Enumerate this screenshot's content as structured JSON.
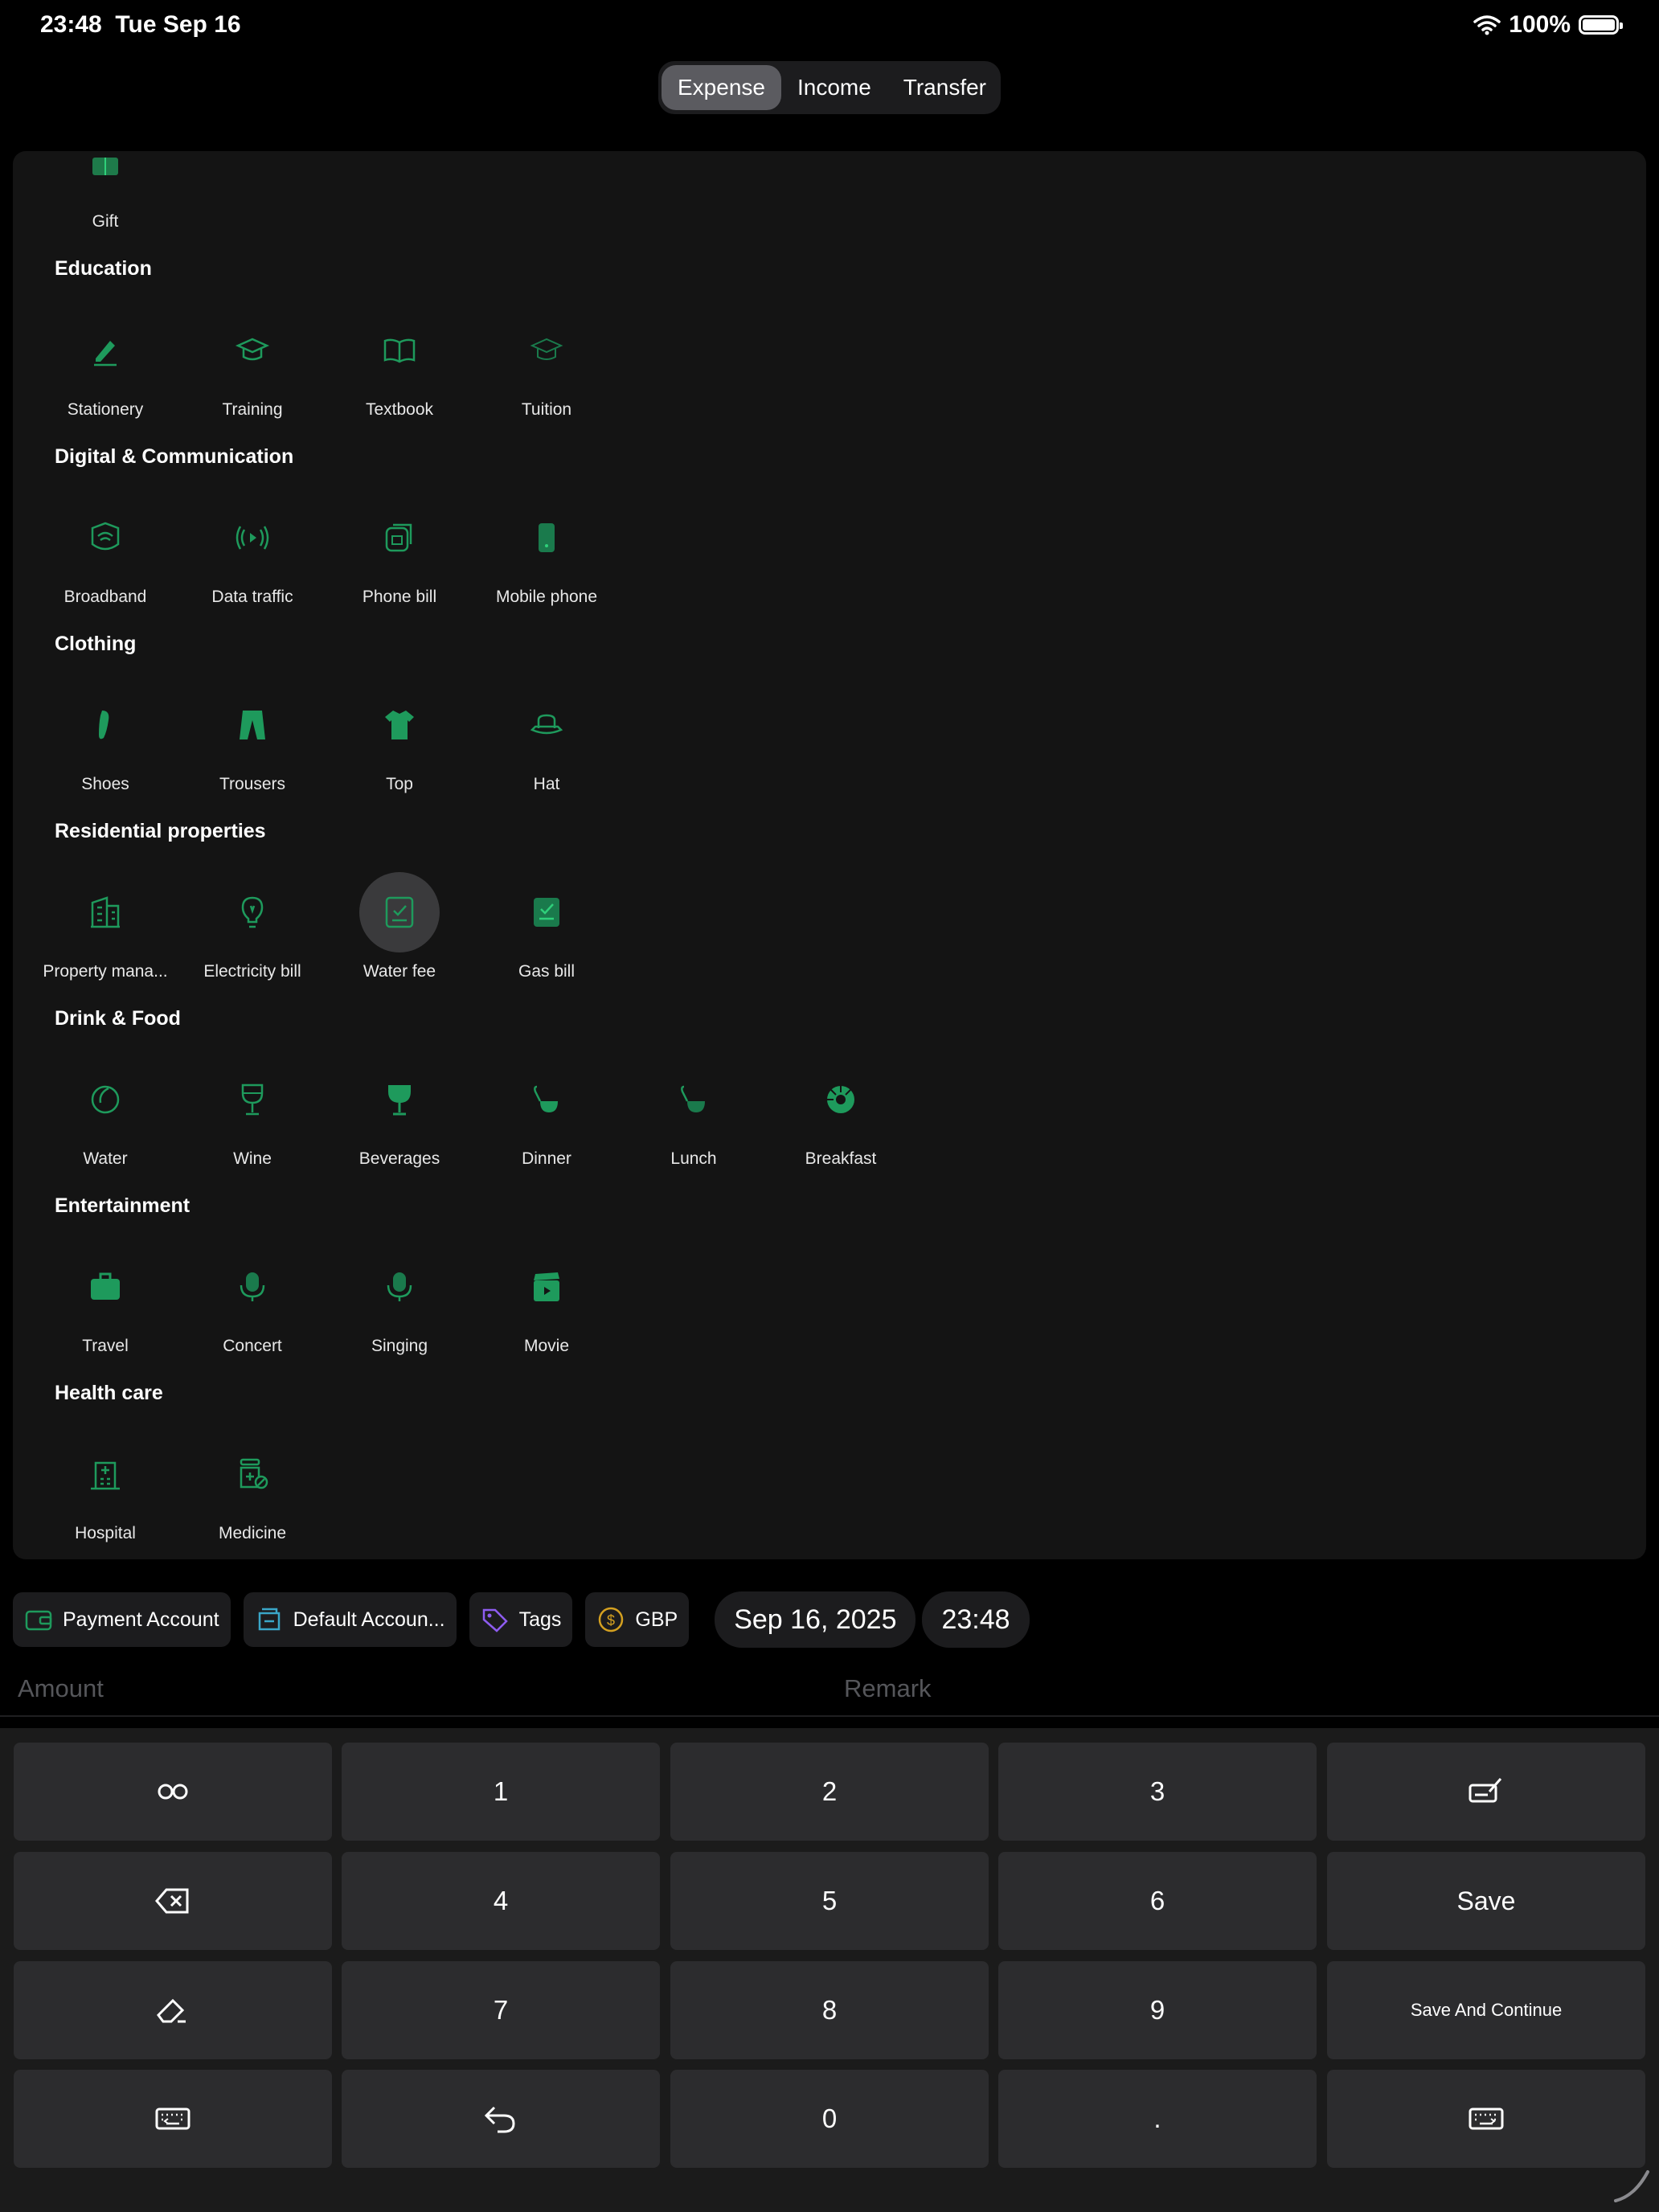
{
  "status_bar": {
    "time": "23:48",
    "date": "Tue Sep 16",
    "battery": "100%",
    "battery_level": 1.0
  },
  "tabs": [
    {
      "label": "Expense",
      "active": true
    },
    {
      "label": "Income",
      "active": false
    },
    {
      "label": "Transfer",
      "active": false
    }
  ],
  "colors": {
    "accent_green": "#1e9a5c",
    "panel_bg": "#141414",
    "key_bg": "#2c2c2e",
    "tag_purple": "#8e5cf0",
    "currency_gold": "#d4a020",
    "account_teal": "#3aa6c8"
  },
  "partial_category": {
    "label": "Gift",
    "icon": "gift-icon"
  },
  "sections": [
    {
      "title": "Education",
      "items": [
        {
          "label": "Stationery",
          "icon": "pen-icon"
        },
        {
          "label": "Training",
          "icon": "graduation-cap-icon"
        },
        {
          "label": "Textbook",
          "icon": "book-icon"
        },
        {
          "label": "Tuition",
          "icon": "graduation-cap-outline-icon"
        }
      ]
    },
    {
      "title": "Digital & Communication",
      "items": [
        {
          "label": "Broadband",
          "icon": "wifi-router-icon"
        },
        {
          "label": "Data traffic",
          "icon": "signal-broadcast-icon"
        },
        {
          "label": "Phone bill",
          "icon": "sim-card-icon"
        },
        {
          "label": "Mobile phone",
          "icon": "mobile-phone-icon"
        }
      ]
    },
    {
      "title": "Clothing",
      "items": [
        {
          "label": "Shoes",
          "icon": "shoe-icon"
        },
        {
          "label": "Trousers",
          "icon": "trousers-icon"
        },
        {
          "label": "Top",
          "icon": "shirt-icon"
        },
        {
          "label": "Hat",
          "icon": "hat-icon"
        }
      ]
    },
    {
      "title": "Residential properties",
      "items": [
        {
          "label": "Property mana...",
          "icon": "building-icon"
        },
        {
          "label": "Electricity bill",
          "icon": "lightbulb-icon"
        },
        {
          "label": "Water fee",
          "icon": "receipt-check-icon",
          "selected": true
        },
        {
          "label": "Gas bill",
          "icon": "receipt-check-filled-icon"
        }
      ]
    },
    {
      "title": "Drink & Food",
      "items": [
        {
          "label": "Water",
          "icon": "water-drop-icon"
        },
        {
          "label": "Wine",
          "icon": "wine-glass-icon"
        },
        {
          "label": "Beverages",
          "icon": "cocktail-glass-icon"
        },
        {
          "label": "Dinner",
          "icon": "ladle-icon"
        },
        {
          "label": "Lunch",
          "icon": "ladle-outline-icon"
        },
        {
          "label": "Breakfast",
          "icon": "bagel-icon"
        }
      ]
    },
    {
      "title": "Entertainment",
      "items": [
        {
          "label": "Travel",
          "icon": "suitcase-icon"
        },
        {
          "label": "Concert",
          "icon": "microphone-icon"
        },
        {
          "label": "Singing",
          "icon": "microphone-stand-icon"
        },
        {
          "label": "Movie",
          "icon": "clapperboard-icon"
        }
      ]
    },
    {
      "title": "Health care",
      "items": [
        {
          "label": "Hospital",
          "icon": "hospital-icon"
        },
        {
          "label": "Medicine",
          "icon": "medicine-bottle-icon"
        }
      ]
    }
  ],
  "chips": {
    "payment_account": "Payment Account",
    "default_account": "Default Accoun...",
    "tags": "Tags",
    "currency": "GBP",
    "date": "Sep 16, 2025",
    "time": "23:48"
  },
  "inputs": {
    "amount_placeholder": "Amount",
    "remark_placeholder": "Remark"
  },
  "keypad": {
    "one": "1",
    "two": "2",
    "three": "3",
    "four": "4",
    "five": "5",
    "six": "6",
    "seven": "7",
    "eight": "8",
    "nine": "9",
    "zero": "0",
    "dot": ".",
    "save": "Save",
    "save_continue": "Save And Continue"
  }
}
